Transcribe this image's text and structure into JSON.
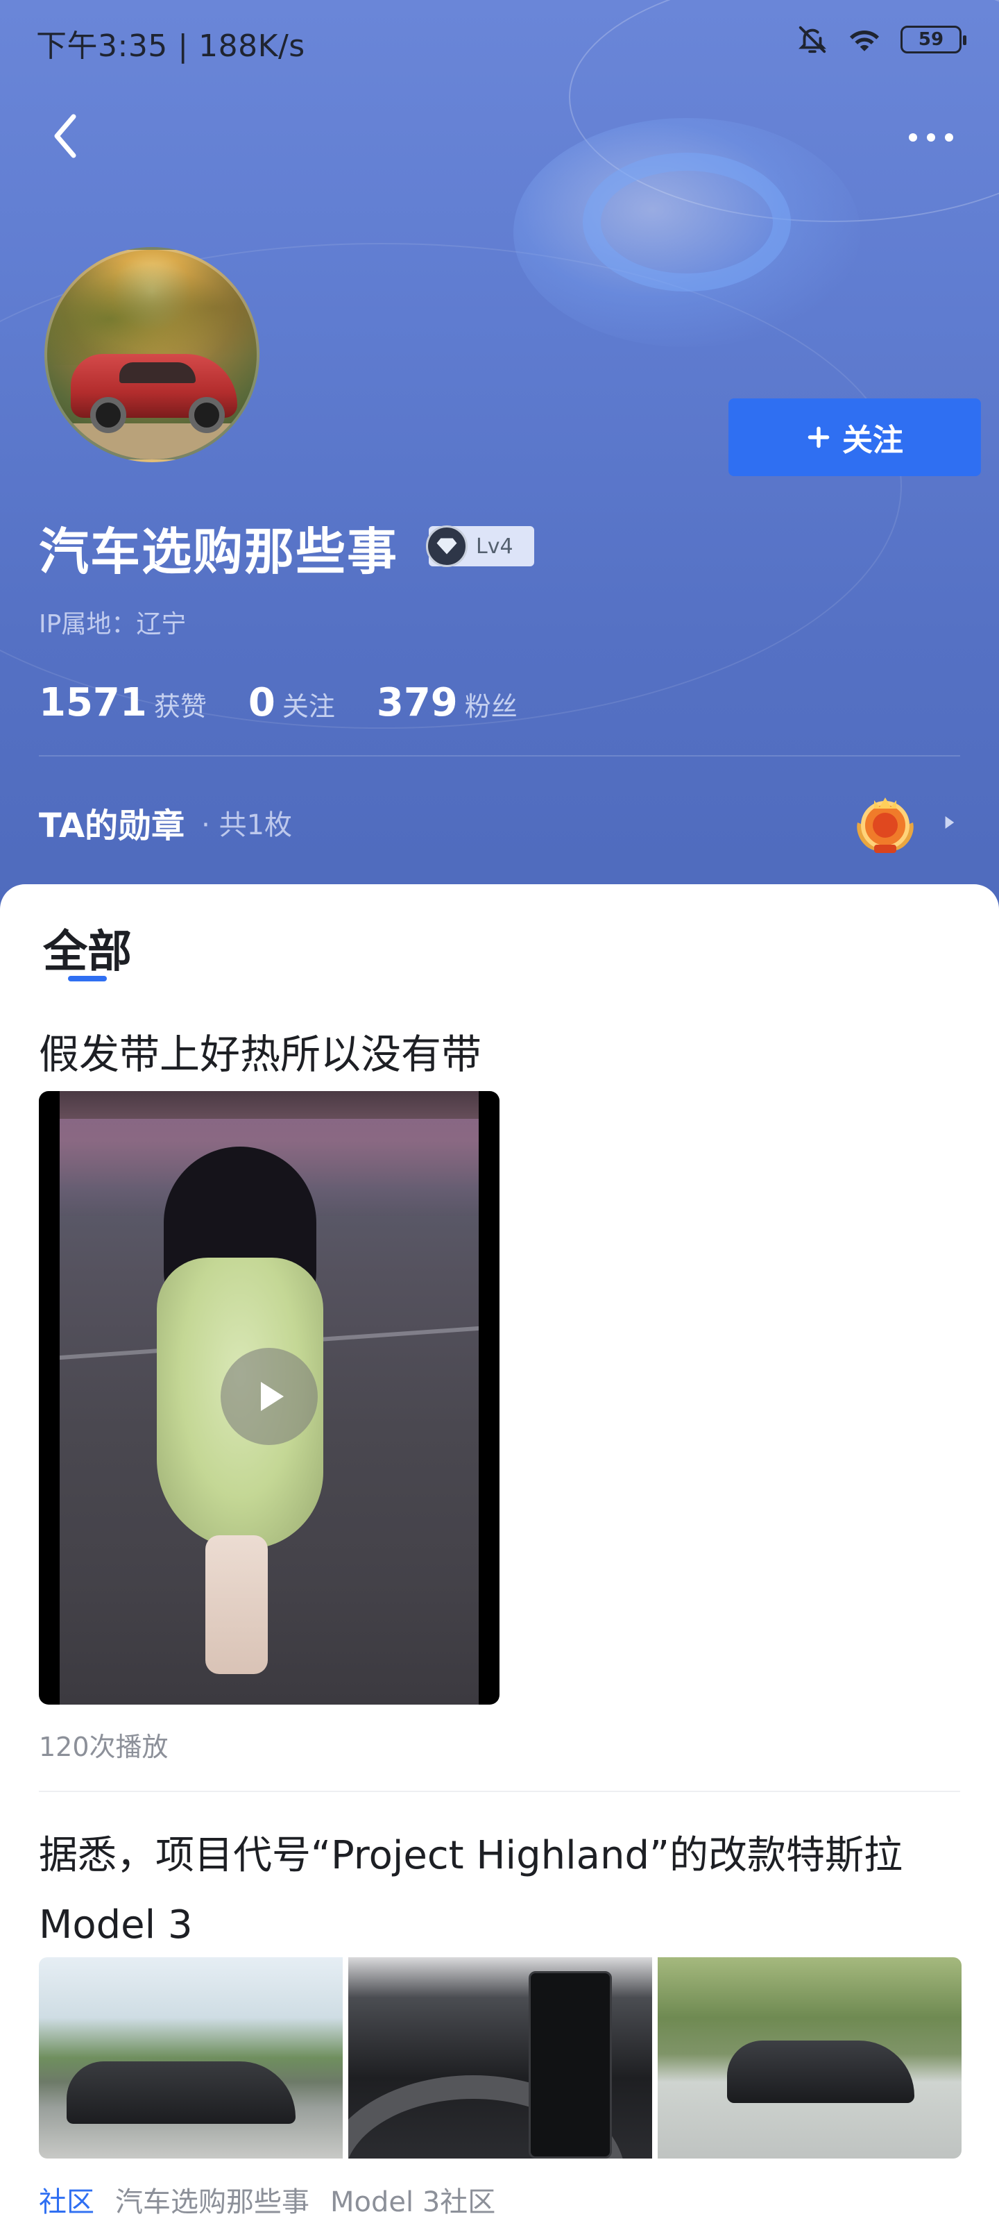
{
  "status_bar": {
    "time": "下午3:35 | 188K/s",
    "battery": "59"
  },
  "profile": {
    "username": "汽车选购那些事",
    "level": "Lv4",
    "ip_location": "IP属地：辽宁",
    "follow_button": "关注"
  },
  "stats": [
    {
      "num": "1571",
      "label": "获赞"
    },
    {
      "num": "0",
      "label": "关注"
    },
    {
      "num": "379",
      "label": "粉丝"
    }
  ],
  "medals": {
    "title": "TA的勋章",
    "count": "· 共1枚"
  },
  "tabs": {
    "all": "全部"
  },
  "posts": [
    {
      "title": "假发带上好热所以没有带",
      "play_count": "120次播放"
    },
    {
      "title": "据悉，项目代号“Project Highland”的改款特斯拉 Model 3",
      "tags": [
        "社区",
        "汽车选购那些事",
        "Model 3社区"
      ]
    }
  ],
  "colors": {
    "accent": "#2f6ff2",
    "header_bg": "#5a76ca"
  }
}
